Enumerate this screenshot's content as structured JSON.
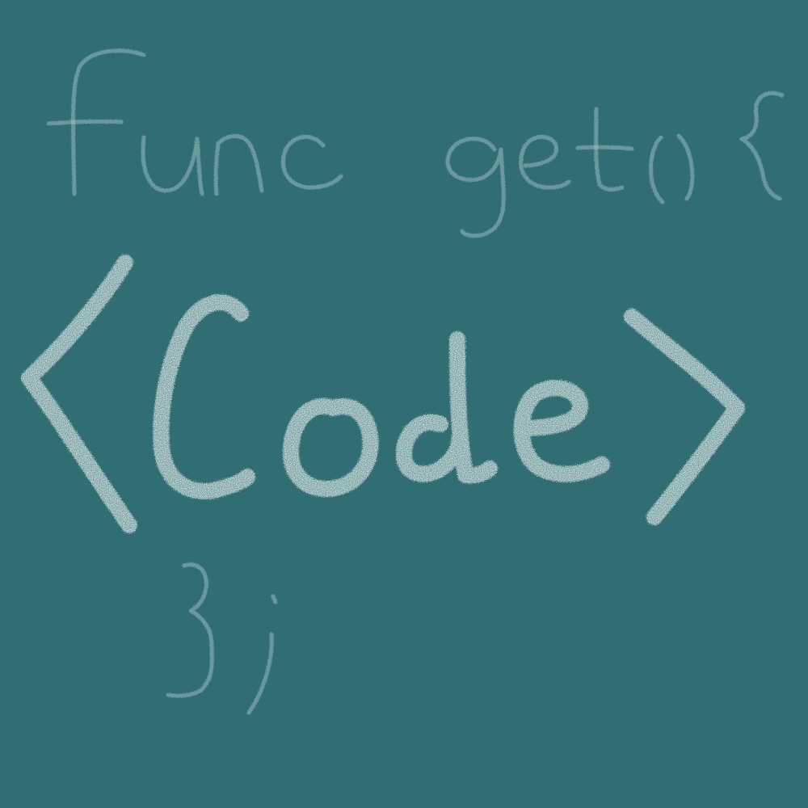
{
  "background_color": "#316e74",
  "chalk_color": "#f3f7f5",
  "faint_chalk_color": "#b9d3d4",
  "artwork": {
    "line_top": "func get(){",
    "main_text": "<Code>",
    "line_bottom": "};"
  }
}
